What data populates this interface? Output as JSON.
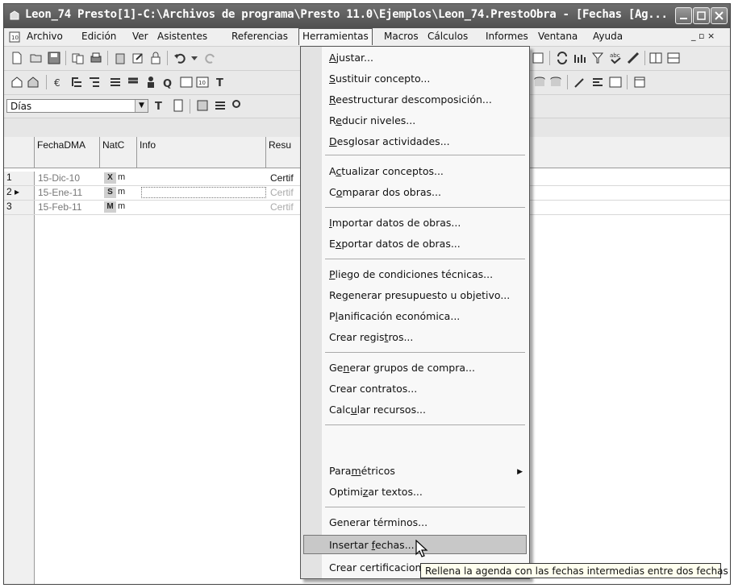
{
  "window": {
    "title": "Leon_74 Presto[1]-C:\\Archivos de programa\\Presto 11.0\\Ejemplos\\Leon_74.PrestoObra - [Fechas [Ag..."
  },
  "menubar": {
    "items": [
      "Archivo",
      "Edición",
      "Ver",
      "Asistentes",
      "Referencias",
      "Herramientas",
      "Macros",
      "Cálculos",
      "Informes",
      "Ventana",
      "Ayuda"
    ],
    "mdi_controls": "_ ▫ ×"
  },
  "combo": {
    "value": "Días"
  },
  "grid": {
    "columns": [
      "FechaDMA",
      "NatC",
      "Info",
      "Resu"
    ],
    "rows": [
      {
        "num": "1",
        "marker": "",
        "fecha": "15-Dic-10",
        "natc": "X",
        "resumen": "Certif"
      },
      {
        "num": "2",
        "marker": "▸",
        "fecha": "15-Ene-11",
        "natc": "S",
        "resumen": "Certif"
      },
      {
        "num": "3",
        "marker": "",
        "fecha": "15-Feb-11",
        "natc": "M",
        "resumen": "Certif"
      }
    ],
    "natc_suffix": "m"
  },
  "menu": {
    "items": [
      {
        "pre": "",
        "acc": "A",
        "post": "justar..."
      },
      {
        "pre": "",
        "acc": "S",
        "post": "ustituir concepto..."
      },
      {
        "pre": "",
        "acc": "R",
        "post": "eestructurar descomposición..."
      },
      {
        "pre": "R",
        "acc": "e",
        "post": "ducir niveles..."
      },
      {
        "pre": "",
        "acc": "D",
        "post": "esglosar actividades..."
      },
      {
        "pre": "A",
        "acc": "c",
        "post": "tualizar conceptos..."
      },
      {
        "pre": "C",
        "acc": "o",
        "post": "mparar dos obras..."
      },
      {
        "pre": "",
        "acc": "I",
        "post": "mportar datos de obras..."
      },
      {
        "pre": "E",
        "acc": "x",
        "post": "portar datos de obras..."
      },
      {
        "pre": "",
        "acc": "P",
        "post": "liego de condiciones técnicas..."
      },
      {
        "pre": "Re",
        "acc": "g",
        "post": "enerar presupuesto u objetivo..."
      },
      {
        "pre": "P",
        "acc": "l",
        "post": "anificación económica..."
      },
      {
        "pre": "Crear regis",
        "acc": "t",
        "post": "ros..."
      },
      {
        "pre": "Ge",
        "acc": "n",
        "post": "erar grupos de compra..."
      },
      {
        "pre": "Crear contratos...",
        "acc": "",
        "post": ""
      },
      {
        "pre": "Calc",
        "acc": "u",
        "post": "lar recursos..."
      },
      {
        "pre": "Para",
        "acc": "m",
        "post": "étricos"
      },
      {
        "pre": "Optimi",
        "acc": "z",
        "post": "ar textos..."
      },
      {
        "pre": "Generar términos...",
        "acc": "",
        "post": ""
      },
      {
        "pre": "Insertar ",
        "acc": "f",
        "post": "echas..."
      },
      {
        "pre": "Crear certificacione",
        "acc": "",
        "post": ""
      }
    ],
    "submenu_arrow": "▶"
  },
  "tooltip": {
    "text": "Rellena la agenda con las fechas intermedias entre dos fechas"
  },
  "colors": {
    "titlebar": "#5a5a5a",
    "menu_bg": "#f8f8f8",
    "highlight": "#c8c8c8",
    "tooltip_bg": "#ffffef"
  }
}
